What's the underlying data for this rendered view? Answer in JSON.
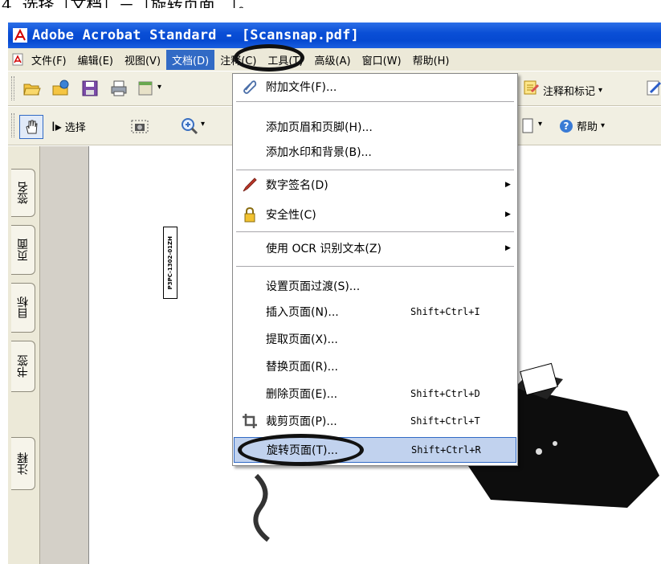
{
  "caption": "4. 选择［文档］－［旋转页面...］。",
  "window": {
    "title": "Adobe Acrobat Standard - [Scansnap.pdf]"
  },
  "menubar": {
    "items": [
      {
        "label": "文件(F)"
      },
      {
        "label": "编辑(E)"
      },
      {
        "label": "视图(V)"
      },
      {
        "label": "文档(D)"
      },
      {
        "label": "注释(C)"
      },
      {
        "label": "工具(T)"
      },
      {
        "label": "高级(A)"
      },
      {
        "label": "窗口(W)"
      },
      {
        "label": "帮助(H)"
      }
    ]
  },
  "toolbar": {
    "select_label": "选择",
    "comment_label": "注释和标记",
    "help_label": "帮助"
  },
  "sidetabs": [
    "签名",
    "页面",
    "目标",
    "书签",
    "注释"
  ],
  "document": {
    "label_code": "P3PC-1302-01ZH"
  },
  "dropdown": {
    "items": [
      {
        "label": "附加文件(F)...",
        "shortcut": "",
        "icon": "paperclip-icon"
      },
      {
        "label": "添加页眉和页脚(H)...",
        "shortcut": ""
      },
      {
        "label": "添加水印和背景(B)...",
        "shortcut": ""
      },
      {
        "label": "数字签名(D)",
        "shortcut": "",
        "icon": "pen-icon",
        "submenu": true
      },
      {
        "label": "安全性(C)",
        "shortcut": "",
        "icon": "lock-icon",
        "submenu": true
      },
      {
        "label": "使用 OCR 识别文本(Z)",
        "shortcut": "",
        "submenu": true
      },
      {
        "label": "设置页面过渡(S)...",
        "shortcut": ""
      },
      {
        "label": "插入页面(N)...",
        "shortcut": "Shift+Ctrl+I"
      },
      {
        "label": "提取页面(X)...",
        "shortcut": ""
      },
      {
        "label": "替换页面(R)...",
        "shortcut": ""
      },
      {
        "label": "删除页面(E)...",
        "shortcut": "Shift+Ctrl+D"
      },
      {
        "label": "裁剪页面(P)...",
        "shortcut": "Shift+Ctrl+T",
        "icon": "crop-icon"
      },
      {
        "label": "旋转页面(T)...",
        "shortcut": "Shift+Ctrl+R",
        "highlighted": true
      }
    ]
  },
  "colors": {
    "titlebar": "#0a4fd6",
    "menu_highlight": "#316ac5",
    "item_highlight": "#c1d2ee"
  }
}
